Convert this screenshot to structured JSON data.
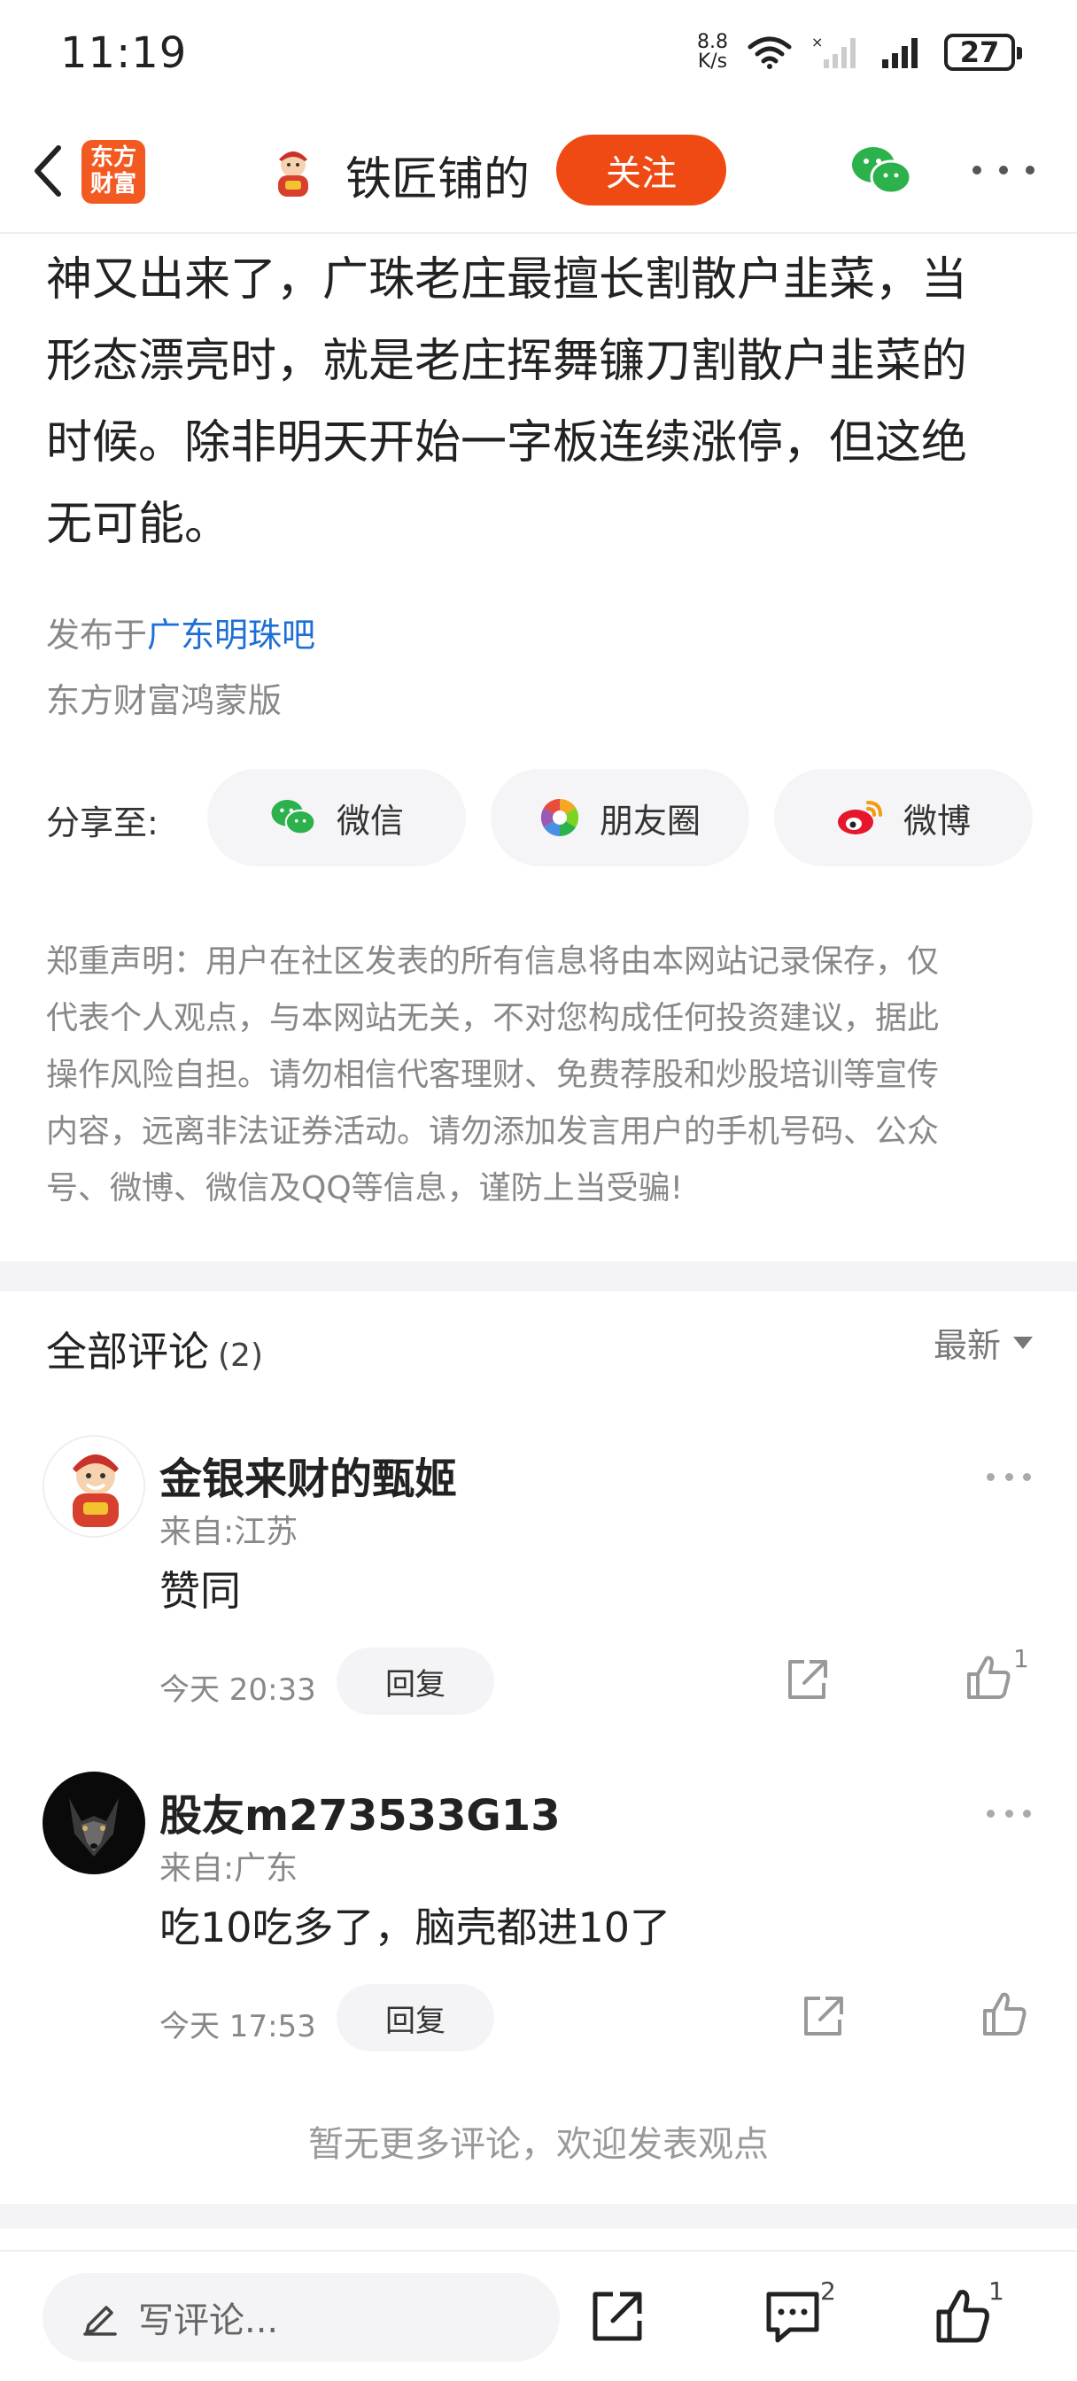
{
  "status_bar": {
    "time": "11:19",
    "net_speed_value": "8.8",
    "net_speed_unit": "K/s",
    "battery": "27"
  },
  "header": {
    "app_logo_line1": "东方",
    "app_logo_line2": "财富",
    "author_name": "铁匠铺的",
    "follow_label": "关注"
  },
  "article": {
    "lines": [
      "神又出来了，广珠老庄最擅长割散户韭菜，当",
      "形态漂亮时，就是老庄挥舞镰刀割散户韭菜的",
      "时候。除非明天开始一字板连续涨停，但这绝",
      "无可能。"
    ],
    "published_prefix": "发布于",
    "forum_link": "广东明珠吧",
    "platform": "东方财富鸿蒙版"
  },
  "share": {
    "label": "分享至:",
    "wechat": "微信",
    "moments": "朋友圈",
    "weibo": "微博"
  },
  "disclaimer_lines": [
    "郑重声明：用户在社区发表的所有信息将由本网站记录保存，仅",
    "代表个人观点，与本网站无关，不对您构成任何投资建议，据此",
    "操作风险自担。请勿相信代客理财、免费荐股和炒股培训等宣传",
    "内容，远离非法证券活动。请勿添加发言用户的手机号码、公众",
    "号、微博、微信及QQ等信息，谨防上当受骗!"
  ],
  "comments_section": {
    "title": "全部评论",
    "count": "(2)",
    "sort_label": "最新",
    "reply_label": "回复",
    "items": [
      {
        "user": "金银来财的甄姬",
        "location": "来自:江苏",
        "text": "赞同",
        "time": "今天 20:33",
        "likes": "1"
      },
      {
        "user": "股友m273533G13",
        "location": "来自:广东",
        "text": "吃10吃多了，脑壳都进10了",
        "time": "今天 17:53",
        "likes": ""
      }
    ],
    "no_more": "暂无更多评论，欢迎发表观点"
  },
  "bottom_bar": {
    "write_placeholder": "写评论...",
    "comment_count": "2",
    "like_count": "1"
  },
  "colors": {
    "brand_orange": "#f04a14",
    "link_blue": "#1d6fd6",
    "wechat_green": "#2bb24c",
    "weibo_red": "#e6162d"
  }
}
